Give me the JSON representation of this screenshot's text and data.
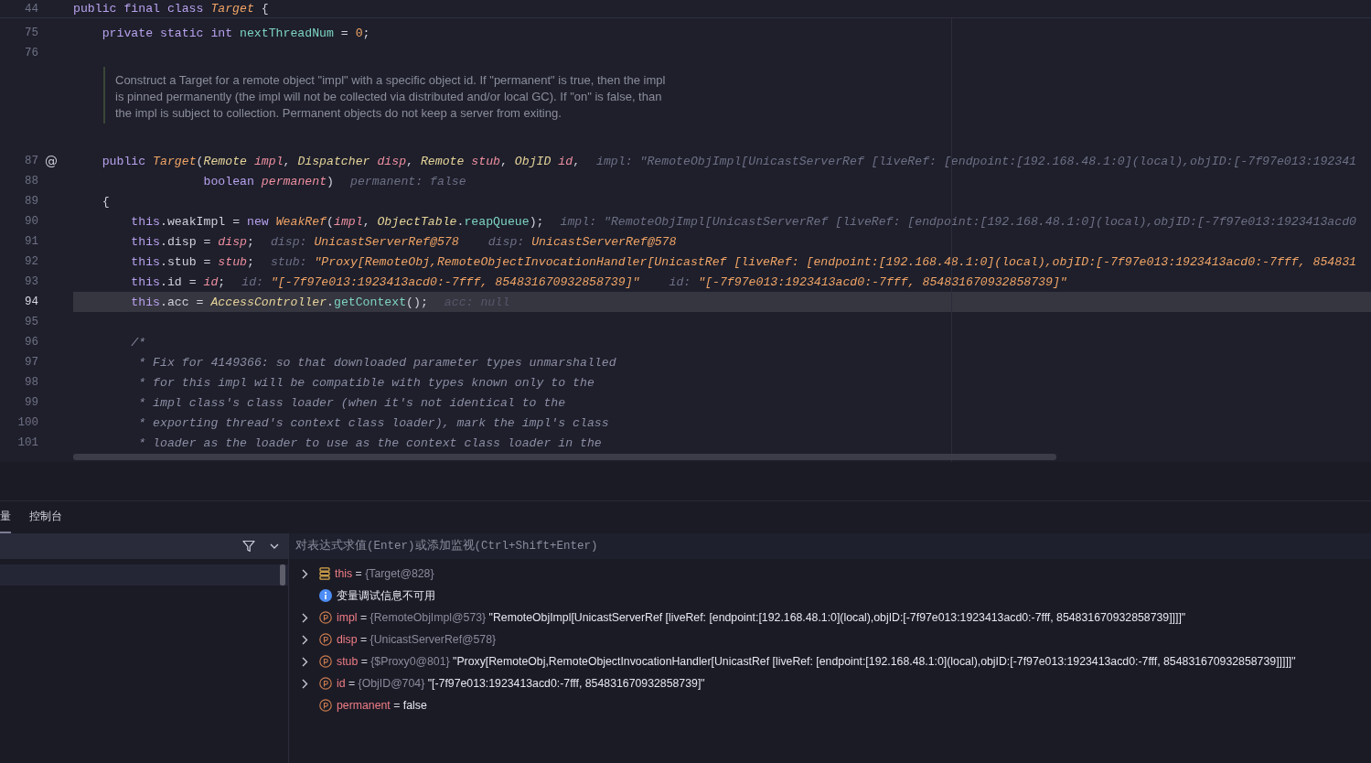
{
  "editor": {
    "sticky_line": {
      "number": "44",
      "tokens": [
        {
          "kind": "kw",
          "text": "public final class "
        },
        {
          "kind": "cls",
          "text": "Target"
        },
        {
          "kind": "p",
          "text": " {"
        }
      ]
    },
    "lines": [
      {
        "kind": "code",
        "number": "75",
        "current": false,
        "tokens": [
          {
            "kind": "kw",
            "text": "private static int "
          },
          {
            "kind": "fn",
            "text": "nextThreadNum"
          },
          {
            "kind": "p",
            "text": " = "
          },
          {
            "kind": "num",
            "text": "0"
          },
          {
            "kind": "p",
            "text": ";"
          }
        ]
      },
      {
        "kind": "code",
        "number": "76",
        "current": false
      },
      {
        "kind": "doc",
        "text": "Construct a Target for a remote object \"impl\" with a specific object id. If \"permanent\" is true, then the impl is pinned permanently (the impl will not be collected via distributed and/or local GC). If \"on\" is false, than the impl is subject to collection. Permanent objects do not keep a server from exiting."
      },
      {
        "kind": "code",
        "number": "87",
        "gutter": "@",
        "current": false,
        "tokens": [
          {
            "kind": "kw",
            "text": "public "
          },
          {
            "kind": "cls",
            "text": "Target"
          },
          {
            "kind": "p",
            "text": "("
          },
          {
            "kind": "type",
            "text": "Remote "
          },
          {
            "kind": "param",
            "text": "impl"
          },
          {
            "kind": "p",
            "text": ", "
          },
          {
            "kind": "type",
            "text": "Dispatcher "
          },
          {
            "kind": "param",
            "text": "disp"
          },
          {
            "kind": "p",
            "text": ", "
          },
          {
            "kind": "type",
            "text": "Remote "
          },
          {
            "kind": "param",
            "text": "stub"
          },
          {
            "kind": "p",
            "text": ", "
          },
          {
            "kind": "type",
            "text": "ObjID "
          },
          {
            "kind": "param",
            "text": "id"
          },
          {
            "kind": "p",
            "text": ","
          }
        ],
        "hints": [
          {
            "kind": "plain",
            "text": "impl: \"RemoteObjImpl[UnicastServerRef [liveRef: [endpoint:[192.168.48.1:0](local),objID:[-7f97e013:192341"
          }
        ],
        "children": [
          {
            "kind": "continuation",
            "number": "88",
            "current": false,
            "tokens": [
              {
                "kind": "kw",
                "text": "boolean "
              },
              {
                "kind": "param",
                "text": "permanent"
              },
              {
                "kind": "p",
                "text": ")"
              }
            ],
            "hints": [
              {
                "kind": "plain",
                "text": "permanent: false"
              }
            ]
          }
        ]
      },
      {
        "kind": "code",
        "number": "89",
        "current": false,
        "tokens": [
          {
            "kind": "p",
            "text": "{"
          }
        ],
        "children": [
          {
            "kind": "code",
            "number": "90",
            "current": false,
            "tokens": [
              {
                "kind": "kw",
                "text": "this"
              },
              {
                "kind": "p",
                "text": ".weakImpl = "
              },
              {
                "kind": "kw",
                "text": "new "
              },
              {
                "kind": "cls",
                "text": "WeakRef"
              },
              {
                "kind": "p",
                "text": "("
              },
              {
                "kind": "param",
                "text": "impl"
              },
              {
                "kind": "p",
                "text": ", "
              },
              {
                "kind": "type",
                "text": "ObjectTable"
              },
              {
                "kind": "p",
                "text": "."
              },
              {
                "kind": "fn",
                "text": "reapQueue"
              },
              {
                "kind": "p",
                "text": ");"
              }
            ],
            "hints": [
              {
                "kind": "plain",
                "text": "impl: \"RemoteObjImpl[UnicastServerRef [liveRef: [endpoint:[192.168.48.1:0](local),objID:[-7f97e013:1923413acd0"
              }
            ]
          },
          {
            "kind": "code",
            "number": "91",
            "current": false,
            "tokens": [
              {
                "kind": "kw",
                "text": "this"
              },
              {
                "kind": "p",
                "text": ".disp = "
              },
              {
                "kind": "param",
                "text": "disp"
              },
              {
                "kind": "p",
                "text": ";"
              }
            ],
            "hints": [
              {
                "kind": "typed",
                "label": "disp:",
                "value": "UnicastServerRef@578"
              },
              {
                "kind": "typed",
                "label": "disp:",
                "value": "UnicastServerRef@578"
              }
            ]
          },
          {
            "kind": "code",
            "number": "92",
            "current": false,
            "tokens": [
              {
                "kind": "kw",
                "text": "this"
              },
              {
                "kind": "p",
                "text": ".stub = "
              },
              {
                "kind": "param",
                "text": "stub"
              },
              {
                "kind": "p",
                "text": ";"
              }
            ],
            "hints": [
              {
                "kind": "typed",
                "label": "stub:",
                "value": "\"Proxy[RemoteObj,RemoteObjectInvocationHandler[UnicastRef [liveRef: [endpoint:[192.168.48.1:0](local),objID:[-7f97e013:1923413acd0:-7fff, 854831"
              }
            ]
          },
          {
            "kind": "code",
            "number": "93",
            "current": false,
            "tokens": [
              {
                "kind": "kw",
                "text": "this"
              },
              {
                "kind": "p",
                "text": ".id = "
              },
              {
                "kind": "param",
                "text": "id"
              },
              {
                "kind": "p",
                "text": ";"
              }
            ],
            "hints": [
              {
                "kind": "typed",
                "label": "id:",
                "value": "\"[-7f97e013:1923413acd0:-7fff, 854831670932858739]\""
              },
              {
                "kind": "typed",
                "label": "id:",
                "value": "\"[-7f97e013:1923413acd0:-7fff, 854831670932858739]\""
              }
            ]
          },
          {
            "kind": "code",
            "number": "94",
            "current": true,
            "tokens": [
              {
                "kind": "kw",
                "text": "this"
              },
              {
                "kind": "p",
                "text": ".acc = "
              },
              {
                "kind": "type",
                "text": "AccessController"
              },
              {
                "kind": "p",
                "text": "."
              },
              {
                "kind": "fn",
                "text": "getContext"
              },
              {
                "kind": "p",
                "text": "();"
              }
            ],
            "hints": [
              {
                "kind": "dim",
                "text": "acc: null"
              }
            ]
          },
          {
            "kind": "code",
            "number": "95",
            "current": false
          },
          {
            "kind": "code",
            "number": "96",
            "current": false,
            "tokens": [
              {
                "kind": "comment",
                "text": "/*"
              }
            ]
          },
          {
            "kind": "comment",
            "number": "97",
            "current": false,
            "tokens": [
              {
                "kind": "comment",
                "text": "* Fix for 4149366: so that downloaded parameter types unmarshalled"
              }
            ]
          },
          {
            "kind": "comment",
            "number": "98",
            "current": false,
            "tokens": [
              {
                "kind": "comment",
                "text": "* for this impl will be compatible with types known only to the"
              }
            ]
          },
          {
            "kind": "comment",
            "number": "99",
            "current": false,
            "tokens": [
              {
                "kind": "comment",
                "text": "* impl class's class loader (when it's not identical to the"
              }
            ]
          },
          {
            "kind": "comment",
            "number": "100",
            "current": false,
            "tokens": [
              {
                "kind": "comment",
                "text": "* exporting thread's context class loader), mark the impl's class"
              }
            ]
          },
          {
            "kind": "comment",
            "number": "101",
            "current": false,
            "tokens": [
              {
                "kind": "comment",
                "text": "* loader as the loader to use as the context class loader in the"
              }
            ]
          }
        ]
      }
    ]
  },
  "debug_panel": {
    "tabs": [
      {
        "label": "量",
        "selected": true
      },
      {
        "label": "控制台",
        "selected": false
      }
    ],
    "evaluate_field": {
      "placeholder": "对表达式求值(Enter)或添加监视(Ctrl+Shift+Enter)"
    },
    "variables": [
      {
        "kind": "this",
        "expanded": false,
        "name": "this",
        "op": "=",
        "type": "{Target@828}"
      },
      {
        "kind": "info",
        "text": "变量调试信息不可用"
      },
      {
        "kind": "field",
        "expanded": false,
        "name": "impl",
        "op": "=",
        "type": "{RemoteObjImpl@573}",
        "value": "\"RemoteObjImpl[UnicastServerRef [liveRef: [endpoint:[192.168.48.1:0](local),objID:[-7f97e013:1923413acd0:-7fff, 854831670932858739]]]]\""
      },
      {
        "kind": "field",
        "expanded": false,
        "name": "disp",
        "op": "=",
        "type": "{UnicastServerRef@578}"
      },
      {
        "kind": "field",
        "expanded": false,
        "name": "stub",
        "op": "=",
        "type": "{$Proxy0@801}",
        "value": "\"Proxy[RemoteObj,RemoteObjectInvocationHandler[UnicastRef [liveRef: [endpoint:[192.168.48.1:0](local),objID:[-7f97e013:1923413acd0:-7fff, 854831670932858739]]]]]\""
      },
      {
        "kind": "field",
        "expanded": false,
        "name": "id",
        "op": "=",
        "type": "{ObjID@704}",
        "value": "\"[-7f97e013:1923413acd0:-7fff, 854831670932858739]\""
      },
      {
        "kind": "field",
        "name": "permanent",
        "op": "=",
        "value": "false"
      }
    ]
  }
}
